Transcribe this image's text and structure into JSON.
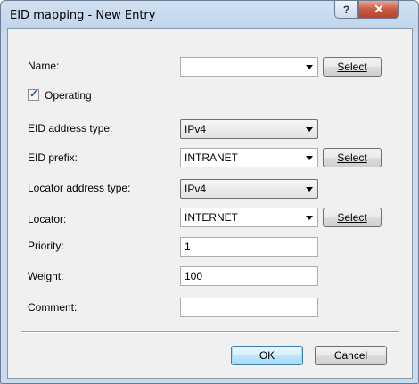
{
  "window": {
    "title": "EID mapping - New Entry",
    "help_label": "?",
    "close_label": "✕"
  },
  "form": {
    "name": {
      "label": "Name:",
      "value": "",
      "select_label": "Select"
    },
    "operating": {
      "label": "Operating",
      "checked": true
    },
    "eid_address_type": {
      "label": "EID address type:",
      "value": "IPv4"
    },
    "eid_prefix": {
      "label": "EID prefix:",
      "value": "INTRANET",
      "select_label": "Select"
    },
    "locator_address_type": {
      "label": "Locator address type:",
      "value": "IPv4"
    },
    "locator": {
      "label": "Locator:",
      "value": "INTERNET",
      "select_label": "Select"
    },
    "priority": {
      "label": "Priority:",
      "value": "1"
    },
    "weight": {
      "label": "Weight:",
      "value": "100"
    },
    "comment": {
      "label": "Comment:",
      "value": ""
    }
  },
  "buttons": {
    "ok": "OK",
    "cancel": "Cancel"
  }
}
